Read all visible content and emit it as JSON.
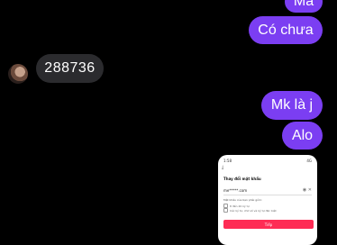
{
  "messages": {
    "outgoing_1": "Ma",
    "outgoing_2": "Có chưa",
    "incoming_1": "288736",
    "outgoing_3": "Mk là j",
    "outgoing_4": "Alo"
  },
  "colors": {
    "outgoing_bubble": "#7b3ef2",
    "incoming_bubble": "#2b2b2e",
    "background": "#000000",
    "primary_button": "#fe2c55"
  },
  "attachment": {
    "status_time": "1:58",
    "status_right": "4G",
    "title": "Thay đổi mật khẩu",
    "field_value": "me*****.com",
    "hint": "Mật khẩu của bạn phải gồm:",
    "rule_1": "8 đến 20 ký tự",
    "rule_2": "Các ký tự, chữ số và ký tự đặc biệt",
    "button_label": "Tiếp"
  }
}
